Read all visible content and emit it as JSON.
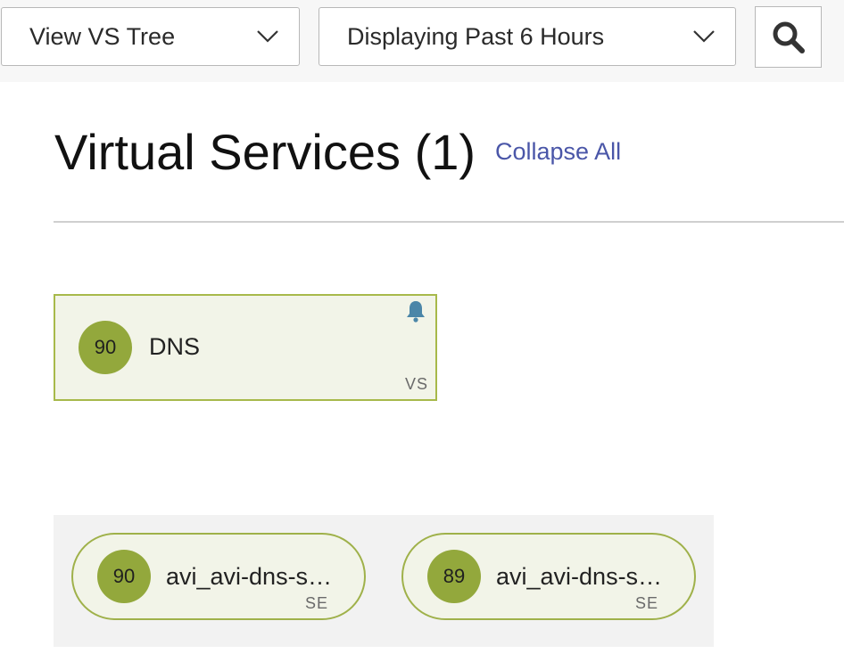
{
  "toolbar": {
    "view_select": {
      "value": "View VS Tree",
      "icon": "chevron-down-icon"
    },
    "time_select": {
      "value": "Displaying Past 6 Hours",
      "icon": "chevron-down-icon"
    },
    "search_icon": "search-icon"
  },
  "page": {
    "title": "Virtual Services (1)",
    "collapse_all": "Collapse All"
  },
  "vs_tree": {
    "virtual_service": {
      "score": "90",
      "name": "DNS",
      "type": "VS",
      "alert_icon": "bell-icon",
      "colors": {
        "fill": "#f2f4e8",
        "border": "#a7b94a",
        "score": "#93a83c"
      }
    },
    "service_engines": [
      {
        "score": "90",
        "name": "avi_avi-dns-s…",
        "type": "SE"
      },
      {
        "score": "89",
        "name": "avi_avi-dns-s…",
        "type": "SE"
      }
    ]
  },
  "colors": {
    "link": "#4a56a8",
    "alert_bell": "#4b86a8",
    "panel_bg": "#f2f2f2"
  }
}
